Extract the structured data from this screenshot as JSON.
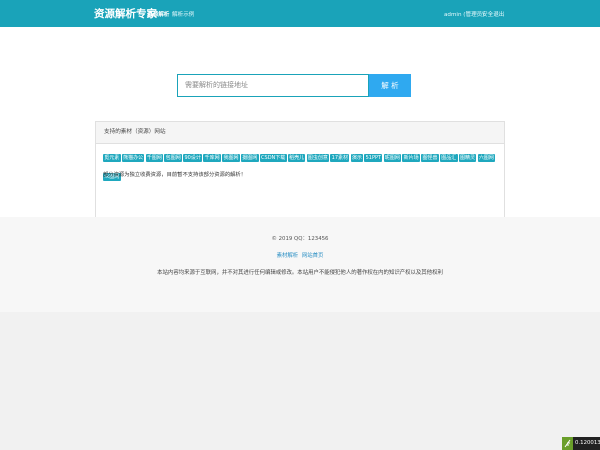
{
  "header": {
    "brand": "资源解析专家",
    "nav": [
      "资源解析",
      "解析示例"
    ],
    "user": "admin (管理员)",
    "logout": "安全退出"
  },
  "search": {
    "placeholder": "需要解析的链接地址",
    "button": "解 析"
  },
  "panel": {
    "title": "支持的素材（资源）网站",
    "tags": [
      "觅元素",
      "熊猫办公",
      "千图网",
      "包图网",
      "90设计",
      "千库网",
      "我图网",
      "摄图网",
      "CSDN下载",
      "稻壳儿",
      "图虫创意",
      "17素材",
      "演示",
      "51PPT",
      "昵图网",
      "新片场",
      "图怪兽",
      "图品汇",
      "图精灵",
      "六图网",
      "众图网"
    ],
    "note": "部分资源为独立收费资源，目前暂不支持该部分资源的解析！"
  },
  "footer": {
    "copyright": "© 2019 QQ：123456",
    "links": [
      "素材解析",
      "网站首页"
    ],
    "disclaimer": "本站内容均来源于互联网，并不对其进行任何编辑或修改。本站用户不能侵犯他人的著作权在内的知识产权以及其他权利"
  },
  "badge": {
    "text": "0.120013s"
  },
  "colors": {
    "accent": "#1aa3b9",
    "button": "#2fa9f0",
    "tag": "#1fa8be"
  }
}
